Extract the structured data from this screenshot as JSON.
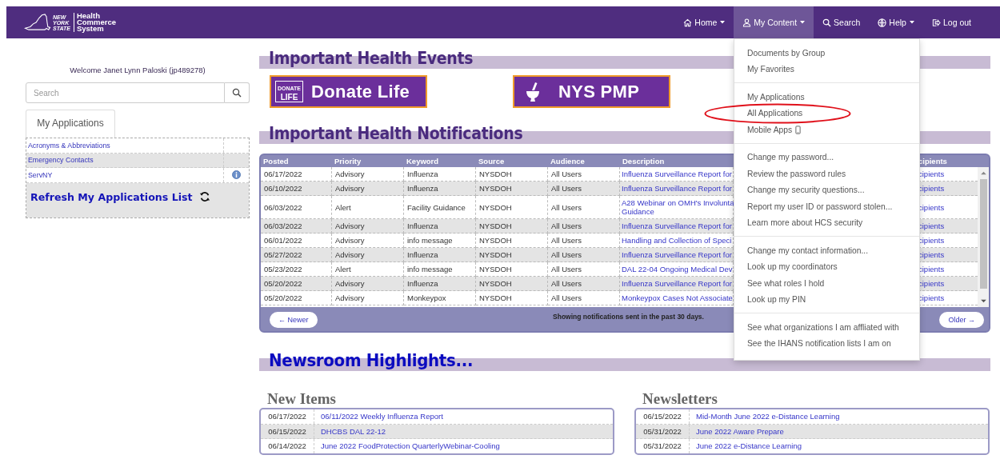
{
  "header": {
    "state_lines": [
      "NEW",
      "YORK",
      "STATE"
    ],
    "site_name_lines": [
      "Health",
      "Commerce",
      "System"
    ]
  },
  "nav": [
    {
      "label": "Home",
      "caret": true,
      "selected": false
    },
    {
      "label": "My Content",
      "caret": true,
      "selected": true
    },
    {
      "label": "Search",
      "caret": false,
      "selected": false
    },
    {
      "label": "Help",
      "caret": true,
      "selected": false
    },
    {
      "label": "Log out",
      "caret": false,
      "selected": false
    }
  ],
  "dropdown_menu": {
    "groups": [
      [
        {
          "label": "Documents by Group",
          "circled": false
        },
        {
          "label": "My Favorites",
          "circled": false
        }
      ],
      [
        {
          "label": "My Applications",
          "circled": false
        },
        {
          "label": "All Applications",
          "circled": true
        },
        {
          "label": "Mobile Apps",
          "circled": false
        }
      ],
      [
        {
          "label": "Change my password...",
          "circled": false
        },
        {
          "label": "Review the password rules",
          "circled": false
        },
        {
          "label": "Change my security questions...",
          "circled": false
        },
        {
          "label": "Report my user ID or password stolen...",
          "circled": false
        },
        {
          "label": "Learn more about HCS security",
          "circled": false
        }
      ],
      [
        {
          "label": "Change my contact information...",
          "circled": false
        },
        {
          "label": "Look up my coordinators",
          "circled": false
        },
        {
          "label": "See what roles I hold",
          "circled": false
        },
        {
          "label": "Look up my PIN",
          "circled": false
        }
      ],
      [
        {
          "label": "See what organizations I am affliated with",
          "circled": false
        },
        {
          "label": "See the IHANS notification lists I am on",
          "circled": false
        }
      ]
    ]
  },
  "sidebar": {
    "welcome": "Welcome Janet Lynn Paloski (jp489278)",
    "search": {
      "placeholder": "Search"
    },
    "tab": "My Applications",
    "applications": [
      {
        "name": "Acronyms & Abbreviations",
        "info": false
      },
      {
        "name": "Emergency Contacts",
        "info": false
      },
      {
        "name": "ServNY",
        "info": true
      }
    ],
    "refresh": "Refresh My Applications List"
  },
  "health_events": {
    "title": "Important Health Events",
    "banners": [
      {
        "kind": "donate",
        "label": "Donate Life",
        "logo_lines": [
          "DONATE",
          "LIFE"
        ]
      },
      {
        "kind": "pmp",
        "label": "NYS PMP"
      }
    ]
  },
  "notifications": {
    "title": "Important Health Notifications",
    "columns": [
      "Posted",
      "Priority",
      "Keyword",
      "Source",
      "Audience",
      "Description",
      "cipients"
    ],
    "rows": [
      {
        "posted": "06/17/2022",
        "priority": "Advisory",
        "keyword": "Influenza",
        "source": "NYSDOH",
        "audience": "All Users",
        "description": "Influenza Surveillance Report for",
        "recipients": "cipients"
      },
      {
        "posted": "06/10/2022",
        "priority": "Advisory",
        "keyword": "Influenza",
        "source": "NYSDOH",
        "audience": "All Users",
        "description": "Influenza Surveillance Report for",
        "recipients": "cipients"
      },
      {
        "posted": "06/03/2022",
        "priority": "Alert",
        "keyword": "Facility Guidance",
        "source": "NYSDOH",
        "audience": "All Users",
        "description": "A28 Webinar on OMH's Involunta\nGuidance",
        "recipients": "cipients"
      },
      {
        "posted": "06/03/2022",
        "priority": "Advisory",
        "keyword": "Influenza",
        "source": "NYSDOH",
        "audience": "All Users",
        "description": "Influenza Surveillance Report for",
        "recipients": "cipients"
      },
      {
        "posted": "06/01/2022",
        "priority": "Advisory",
        "keyword": "info message",
        "source": "NYSDOH",
        "audience": "All Users",
        "description": "Handling and Collection of Speci",
        "recipients": "cipients"
      },
      {
        "posted": "05/27/2022",
        "priority": "Advisory",
        "keyword": "Influenza",
        "source": "NYSDOH",
        "audience": "All Users",
        "description": "Influenza Surveillance Report for",
        "recipients": "cipients"
      },
      {
        "posted": "05/23/2022",
        "priority": "Alert",
        "keyword": "info message",
        "source": "NYSDOH",
        "audience": "All Users",
        "description": "DAL 22-04 Ongoing Medical Dev",
        "recipients": "cipients"
      },
      {
        "posted": "05/20/2022",
        "priority": "Advisory",
        "keyword": "Influenza",
        "source": "NYSDOH",
        "audience": "All Users",
        "description": "Influenza Surveillance Report for",
        "recipients": "cipients"
      },
      {
        "posted": "05/20/2022",
        "priority": "Advisory",
        "keyword": "Monkeypox",
        "source": "NYSDOH",
        "audience": "All Users",
        "description": "Monkeypox Cases Not Associate",
        "recipients": "cipients"
      }
    ],
    "newer": "← Newer",
    "footer_text": "Showing notifications sent in the past 30 days.",
    "older": "Older →"
  },
  "newsroom": {
    "title": "Newsroom Highlights...",
    "lists": [
      {
        "title": "New Items",
        "rows": [
          {
            "date": "06/17/2022",
            "title": "06/11/2022 Weekly Influenza Report"
          },
          {
            "date": "06/15/2022",
            "title": "DHCBS DAL 22-12"
          },
          {
            "date": "06/14/2022",
            "title": "June 2022 FoodProtection QuarterlyWebinar-Cooling"
          }
        ]
      },
      {
        "title": "Newsletters",
        "rows": [
          {
            "date": "06/15/2022",
            "title": "Mid-Month June 2022 e-Distance Learning"
          },
          {
            "date": "05/31/2022",
            "title": "June 2022 Aware Prepare"
          },
          {
            "date": "05/31/2022",
            "title": "June 2022 e-Distance Learning"
          }
        ]
      }
    ]
  }
}
